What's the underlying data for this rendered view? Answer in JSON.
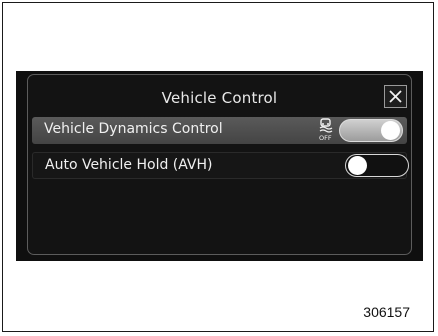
{
  "dialog": {
    "title": "Vehicle Control",
    "close_icon": "close-icon"
  },
  "settings": [
    {
      "label": "Vehicle Dynamics Control",
      "state": "on",
      "icon": "vehicle-dynamics-off-icon",
      "icon_text": "OFF"
    },
    {
      "label": "Auto Vehicle Hold (AVH)",
      "state": "off"
    }
  ],
  "figure_number": "306157",
  "colors": {
    "screen_background": "#0f0f0f",
    "selected_row": "#505050",
    "toggle_knob": "#ffffff"
  }
}
